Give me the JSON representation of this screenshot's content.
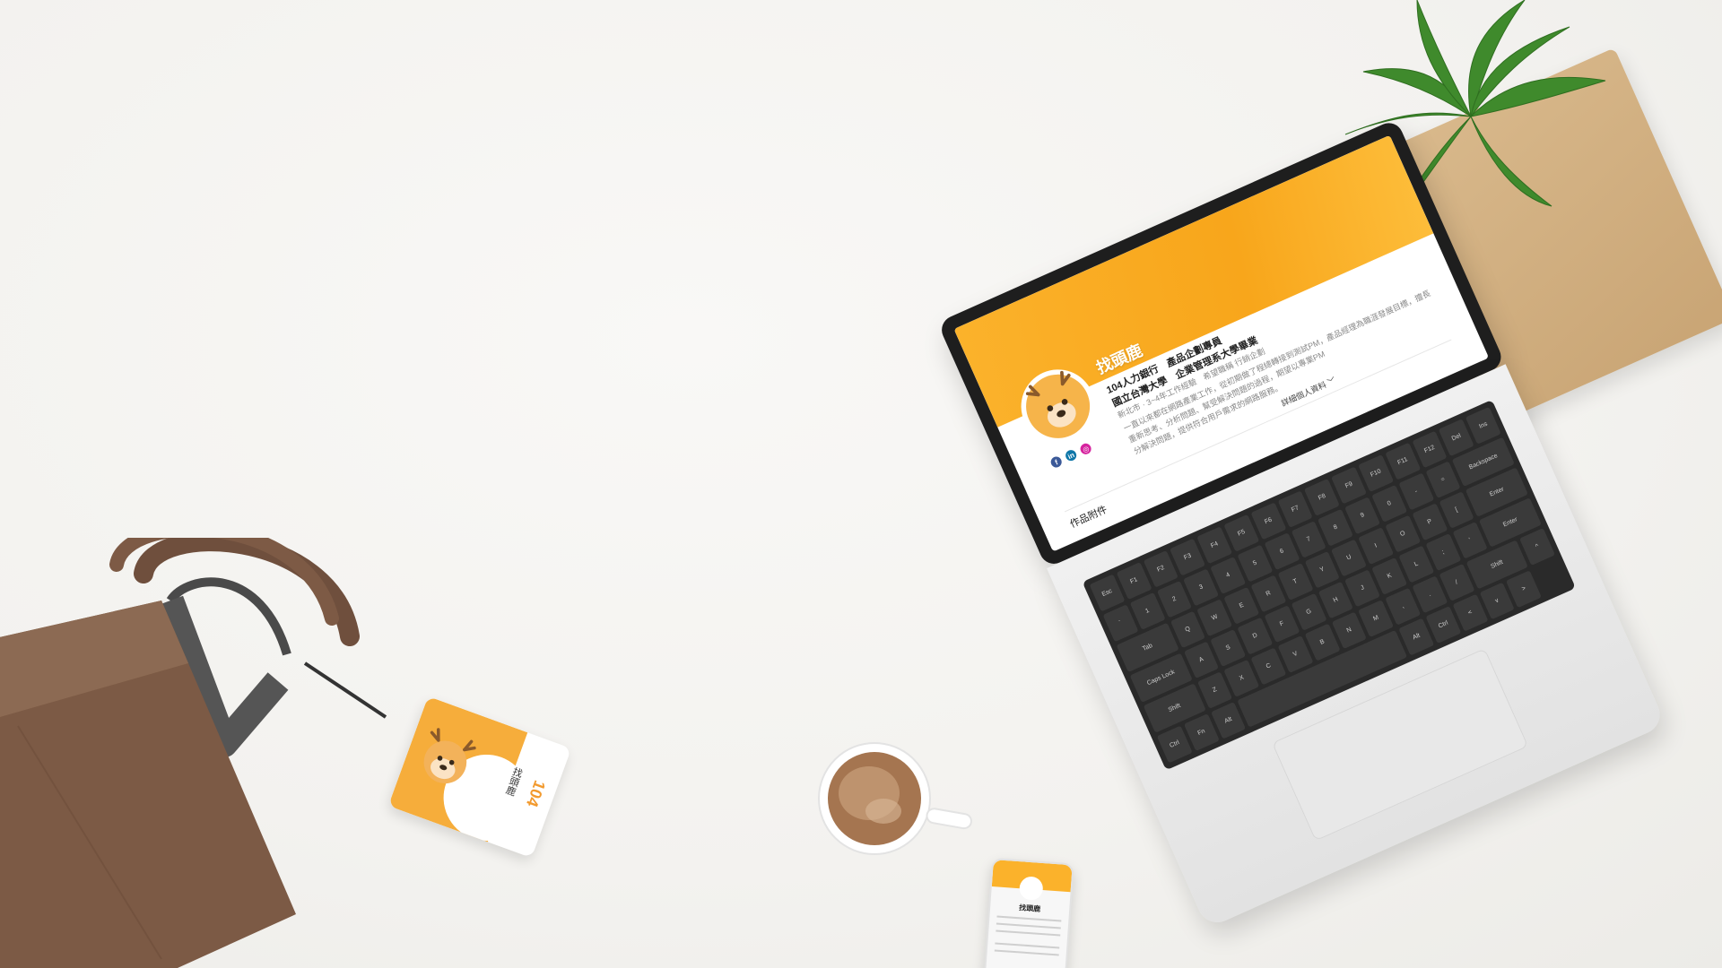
{
  "profile": {
    "name": "找頭鹿",
    "company_title": "104人力銀行　產品企劃專員",
    "education": "國立台灣大學　企業管理系大學畢業",
    "meta": "新北市 · 3~4年工作經驗　希望職稱 行銷企劃",
    "summary_1": "一直以來都在網路產業工作，從初期做了程總轉接到測試PM，產品經理為職涯發展目標，擅長",
    "summary_2": "重新思考、分析問題、幫受解決問題的過程，期望以專業PM",
    "summary_3": "分解決問題，提供符合用戶需求的網路服務。",
    "more_label": "詳細個人資料 ﹀",
    "portfolio_label": "作品附件"
  },
  "badge": {
    "name": "找頭鹿",
    "logo": "104"
  },
  "phone": {
    "name": "找頭鹿"
  },
  "social": {
    "facebook": "f",
    "linkedin": "in",
    "instagram": "◎"
  },
  "colors": {
    "brand_orange": "#f8a61b",
    "bag_brown": "#7c5a45",
    "plant_green": "#3f8a2c",
    "notebook_kraft": "#d2ae7d"
  }
}
